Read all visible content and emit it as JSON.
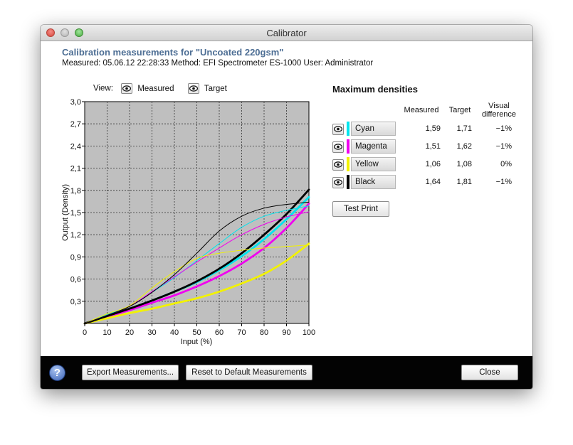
{
  "window": {
    "title": "Calibrator"
  },
  "header": {
    "heading": "Calibration measurements for \"Uncoated 220gsm\"",
    "subline": "Measured: 05.06.12 22:28:33   Method: EFI Spectrometer ES-1000   User: Administrator"
  },
  "view": {
    "label": "View:",
    "measured_label": "Measured",
    "target_label": "Target"
  },
  "chart_data": {
    "type": "line",
    "xlabel": "Input (%)",
    "ylabel": "Output (Density)",
    "xlim": [
      0,
      100
    ],
    "ylim": [
      0,
      3.0
    ],
    "x_ticks": [
      "0",
      "10",
      "20",
      "30",
      "40",
      "50",
      "60",
      "70",
      "80",
      "90",
      "100"
    ],
    "y_ticks": [
      "0,3",
      "0,6",
      "0,9",
      "1,2",
      "1,5",
      "1,8",
      "2,1",
      "2,4",
      "2,7",
      "3,0"
    ],
    "grid": true,
    "series": [
      {
        "name": "Cyan",
        "color": "#00e5ee",
        "kind": "target",
        "x": [
          0,
          10,
          20,
          30,
          40,
          50,
          60,
          70,
          80,
          90,
          100
        ],
        "y": [
          0,
          0.1,
          0.2,
          0.31,
          0.43,
          0.56,
          0.72,
          0.91,
          1.14,
          1.41,
          1.71
        ]
      },
      {
        "name": "Magenta",
        "color": "#f000f0",
        "kind": "target",
        "x": [
          0,
          10,
          20,
          30,
          40,
          50,
          60,
          70,
          80,
          90,
          100
        ],
        "y": [
          0,
          0.09,
          0.18,
          0.28,
          0.38,
          0.5,
          0.64,
          0.81,
          1.02,
          1.29,
          1.62
        ]
      },
      {
        "name": "Yellow",
        "color": "#f2f200",
        "kind": "target",
        "x": [
          0,
          10,
          20,
          30,
          40,
          50,
          60,
          70,
          80,
          90,
          100
        ],
        "y": [
          0,
          0.07,
          0.14,
          0.2,
          0.27,
          0.34,
          0.43,
          0.54,
          0.67,
          0.85,
          1.08
        ]
      },
      {
        "name": "Black",
        "color": "#000000",
        "kind": "target",
        "x": [
          0,
          10,
          20,
          30,
          40,
          50,
          60,
          70,
          80,
          90,
          100
        ],
        "y": [
          0,
          0.1,
          0.2,
          0.31,
          0.43,
          0.57,
          0.74,
          0.95,
          1.2,
          1.48,
          1.81
        ]
      },
      {
        "name": "Cyan",
        "color": "#00e5ee",
        "kind": "measured",
        "x": [
          0,
          10,
          20,
          30,
          40,
          50,
          60,
          70,
          80,
          90,
          100
        ],
        "y": [
          0,
          0.12,
          0.23,
          0.42,
          0.62,
          0.85,
          1.08,
          1.3,
          1.45,
          1.53,
          1.59
        ]
      },
      {
        "name": "Magenta",
        "color": "#f000f0",
        "kind": "measured",
        "x": [
          0,
          10,
          20,
          30,
          40,
          50,
          60,
          70,
          80,
          90,
          100
        ],
        "y": [
          0,
          0.11,
          0.23,
          0.43,
          0.63,
          0.83,
          1.02,
          1.2,
          1.34,
          1.44,
          1.51
        ]
      },
      {
        "name": "Yellow",
        "color": "#f2f200",
        "kind": "measured",
        "x": [
          0,
          10,
          20,
          30,
          40,
          50,
          60,
          70,
          80,
          90,
          100
        ],
        "y": [
          0,
          0.13,
          0.24,
          0.48,
          0.7,
          0.88,
          0.95,
          0.99,
          1.02,
          1.04,
          1.06
        ]
      },
      {
        "name": "Black",
        "color": "#000000",
        "kind": "measured",
        "x": [
          0,
          10,
          20,
          30,
          40,
          50,
          60,
          70,
          80,
          90,
          100
        ],
        "y": [
          0,
          0.11,
          0.23,
          0.42,
          0.66,
          0.95,
          1.25,
          1.45,
          1.56,
          1.61,
          1.64
        ]
      }
    ]
  },
  "max_densities": {
    "title": "Maximum densities",
    "columns": [
      "Measured",
      "Target",
      "Visual difference"
    ],
    "visual_diff_line1": "Visual",
    "visual_diff_line2": "difference",
    "rows": [
      {
        "name": "Cyan",
        "color": "#00e5ee",
        "measured": "1,59",
        "target": "1,71",
        "diff": "−1%"
      },
      {
        "name": "Magenta",
        "color": "#f000f0",
        "measured": "1,51",
        "target": "1,62",
        "diff": "−1%"
      },
      {
        "name": "Yellow",
        "color": "#f2f200",
        "measured": "1,06",
        "target": "1,08",
        "diff": "0%"
      },
      {
        "name": "Black",
        "color": "#000000",
        "measured": "1,64",
        "target": "1,81",
        "diff": "−1%"
      }
    ],
    "test_print_label": "Test Print"
  },
  "footer": {
    "help_glyph": "?",
    "export_label": "Export Measurements...",
    "reset_label": "Reset to Default Measurements",
    "close_label": "Close"
  },
  "icons": {
    "eye": "eye-icon",
    "help": "help-icon"
  }
}
